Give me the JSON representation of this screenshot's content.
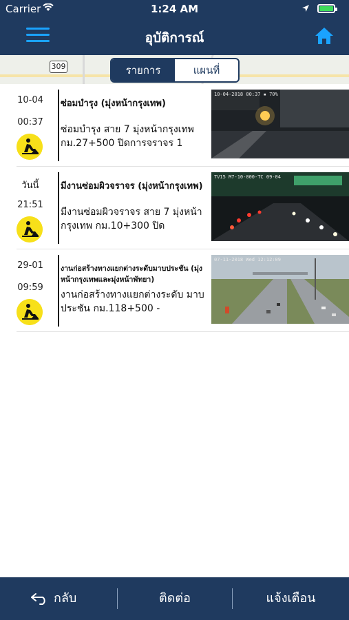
{
  "status_bar": {
    "carrier": "Carrier",
    "time": "1:24 AM"
  },
  "header": {
    "title": "อุบัติการณ์"
  },
  "map": {
    "route_shield": "309"
  },
  "segment": {
    "list_label": "รายการ",
    "map_label": "แผนที่",
    "selected": "รายการ"
  },
  "incidents": [
    {
      "date": "10-04",
      "time": "00:37",
      "title": "ซ่อมบำรุง (มุ่งหน้ากรุงเทพ)",
      "description": "ซ่อมบำรุง สาย 7 มุ่งหน้ากรุงเทพ กม.27+500 ปิดการจราจร 1",
      "camera_stamp": "10-04-2018 00:37 ▪ 70%"
    },
    {
      "date": "วันนี้",
      "time": "21:51",
      "title": "มีงานซ่อมผิวจราจร (มุ่งหน้ากรุงเทพ)",
      "description": "มีงานซ่อมผิวจราจร สาย 7 มุ่งหน้ากรุงเทพ กม.10+300 ปิด",
      "camera_stamp": "TV15 M7-10-000-TC  09-04"
    },
    {
      "date": "29-01",
      "time": "09:59",
      "title": "งานก่อสร้างทางแยกต่างระดับมาบประชัน (มุ่งหน้ากรุงเทพและมุ่งหน้าพัทยา)",
      "description": "งานก่อสร้างทางแยกต่างระดับ มาบประชัน กม.118+500 -",
      "camera_stamp": "07-11-2018 Wed 12:12:09"
    }
  ],
  "footer": {
    "back_label": "กลับ",
    "contact_label": "ติดต่อ",
    "report_label": "แจ้งเตือน"
  },
  "colors": {
    "navy": "#1f3a5f",
    "accent": "#1aa3ff",
    "badge": "#f7e01a"
  },
  "icons": [
    "wifi-icon",
    "location-arrow-icon",
    "battery-icon",
    "menu-icon",
    "home-icon",
    "road-work-icon",
    "back-arrow-icon"
  ]
}
